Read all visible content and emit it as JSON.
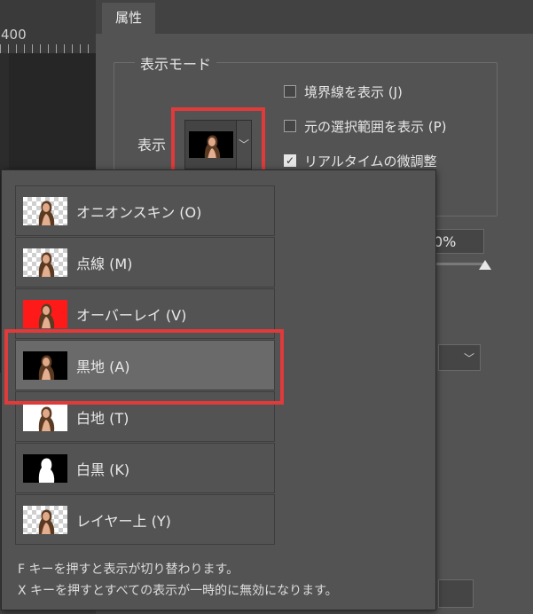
{
  "ruler": {
    "label": "400"
  },
  "panel": {
    "tab": "属性"
  },
  "display_mode": {
    "group_title": "表示モード",
    "display_label": "表示",
    "checkboxes": [
      {
        "label": "境界線を表示 (J)",
        "checked": false
      },
      {
        "label": "元の選択範囲を表示 (P)",
        "checked": false
      },
      {
        "label": "リアルタイムの微調整",
        "checked": true
      }
    ]
  },
  "opacity_value": "0%",
  "dropdown_items": [
    {
      "label": "オニオンスキン (O)",
      "thumb": "checker-portrait"
    },
    {
      "label": "点線 (M)",
      "thumb": "checker-portrait"
    },
    {
      "label": "オーバーレイ (V)",
      "thumb": "red-portrait"
    },
    {
      "label": "黒地 (A)",
      "thumb": "black-portrait",
      "selected": true
    },
    {
      "label": "白地 (T)",
      "thumb": "white-portrait"
    },
    {
      "label": "白黒 (K)",
      "thumb": "mask-silhouette"
    },
    {
      "label": "レイヤー上 (Y)",
      "thumb": "checker-portrait"
    }
  ],
  "hints": [
    "F キーを押すと表示が切り替わります。",
    "X キーを押すとすべての表示が一時的に無効になります。"
  ],
  "colors": {
    "highlight": "#e03a3a",
    "panel": "#535353",
    "selected": "#6a6a6a"
  }
}
